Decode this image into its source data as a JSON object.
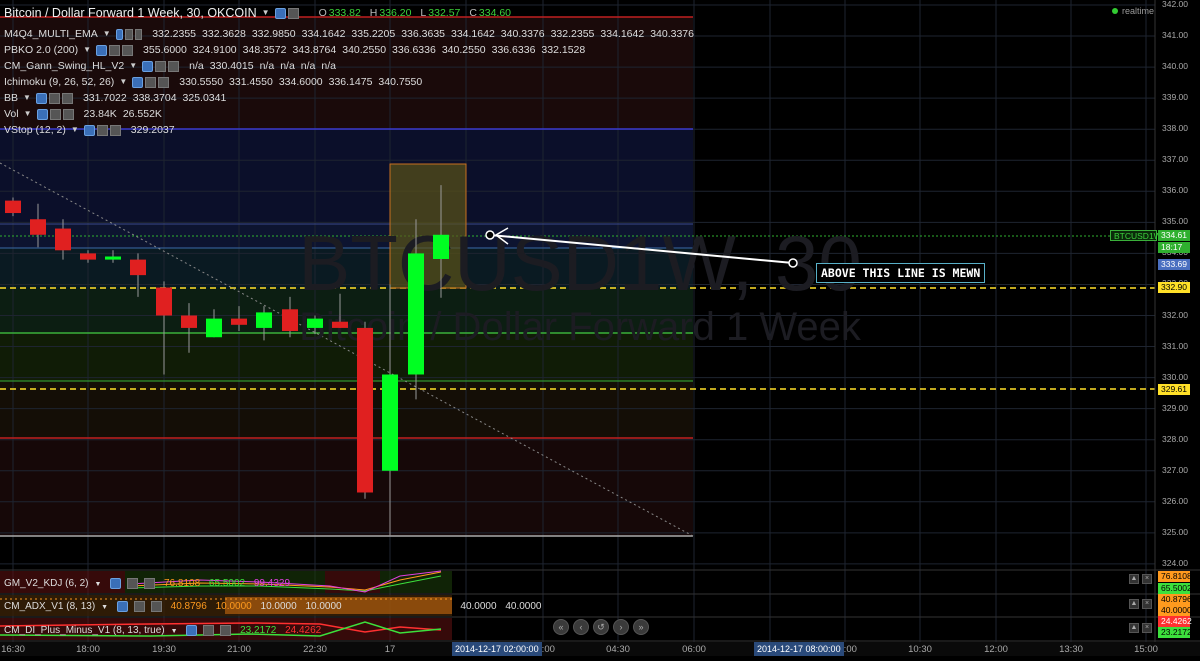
{
  "header": {
    "symbol_title": "Bitcoin / Dollar Forward 1 Week, 30, OKCOIN",
    "ohlc": [
      {
        "k": "O",
        "v": "333.82"
      },
      {
        "k": "H",
        "v": "336.20"
      },
      {
        "k": "L",
        "v": "332.57"
      },
      {
        "k": "C",
        "v": "334.60"
      }
    ],
    "realtime_label": "realtime"
  },
  "indicators": [
    {
      "name": "M4Q4_MULTI_EMA",
      "values": [
        "332.2355",
        "332.3628",
        "332.9850",
        "334.1642",
        "335.2205",
        "336.3635",
        "334.1642",
        "340.3376",
        "332.2355",
        "334.1642",
        "340.3376"
      ]
    },
    {
      "name": "PBKO 2.0 (200)",
      "values": [
        "355.6000",
        "324.9100",
        "348.3572",
        "343.8764",
        "340.2550",
        "336.6336",
        "340.2550",
        "336.6336",
        "332.1528"
      ]
    },
    {
      "name": "CM_Gann_Swing_HL_V2",
      "values": [
        "n/a",
        "330.4015",
        "n/a",
        "n/a",
        "n/a",
        "n/a"
      ]
    },
    {
      "name": "Ichimoku (9, 26, 52, 26)",
      "values": [
        "330.5550",
        "331.4550",
        "334.6000",
        "336.1475",
        "340.7550"
      ]
    },
    {
      "name": "BB",
      "values": [
        "331.7022",
        "338.3704",
        "325.0341"
      ]
    },
    {
      "name": "Vol",
      "values": [
        "23.84K",
        "26.552K"
      ]
    },
    {
      "name": "VStop (12, 2)",
      "values": [
        "329.2037"
      ]
    }
  ],
  "watermark": {
    "line1": "BTCUSD1W, 30",
    "line2": "Bitcoin / Dollar Forward 1 Week"
  },
  "annotation": {
    "text": "ABOVE THIS LINE IS MEWN"
  },
  "price_axis": [
    "342.00",
    "341.00",
    "340.00",
    "339.00",
    "338.00",
    "337.00",
    "336.00",
    "335.00",
    "334.00",
    "333.00",
    "332.00",
    "331.00",
    "330.00",
    "329.00",
    "328.00",
    "327.00",
    "326.00",
    "325.00",
    "324.00"
  ],
  "price_tags": {
    "symbol": "BTCUSD1W",
    "last": "334.61",
    "countdown": "18:17",
    "blue": "333.69",
    "yellow_upper": "332.90",
    "yellow_lower": "329.61"
  },
  "sub_panes": [
    {
      "name": "GM_V2_KDJ (6, 2)",
      "values": [
        "76.8108",
        "65.5002",
        "99.4329"
      ],
      "colors": [
        "#ff9a1e",
        "#3ce03c",
        "#e040e0"
      ],
      "axis_values": [
        "76.8108",
        "65.5002"
      ]
    },
    {
      "name": "CM_ADX_V1 (8, 13)",
      "values": [
        "40.8796",
        "10.0000",
        "10.0000",
        "10.0000",
        "40.0000",
        "40.0000"
      ],
      "colors": [
        "#ff9a1e",
        "#ff9a1e",
        "#ffffff",
        "#ffffff",
        "#ffffff",
        "#ffffff"
      ],
      "axis_values": [
        "40.8796",
        "40.0000"
      ]
    },
    {
      "name": "CM_DI_Plus_Minus_V1 (8, 13, true)",
      "values": [
        "23.2172",
        "24.4262"
      ],
      "colors": [
        "#3ce03c",
        "#ff3030"
      ],
      "axis_values": [
        "24.4262",
        "23.2172"
      ]
    }
  ],
  "time_axis": [
    "16:30",
    "18:00",
    "19:30",
    "21:00",
    "22:30",
    "17",
    "03:00",
    "04:30",
    "06:00",
    "09:00",
    "10:30",
    "12:00",
    "13:30",
    "15:00"
  ],
  "time_highlights": [
    "2014-12-17 02:00:00",
    "2014-12-17 08:00:00"
  ],
  "nav_buttons": [
    "«",
    "‹",
    "↺",
    "›",
    "»"
  ],
  "colors": {
    "bull": "#00ff22",
    "bear": "#e02020",
    "ema_line": "#3ab03a",
    "band_blue": "#3a3ad0",
    "band_red": "#c02020",
    "yellow": "#ffe028"
  },
  "chart_data": {
    "type": "candlestick",
    "ylim": [
      324.8,
      342.2
    ],
    "candles": [
      {
        "o": 335.7,
        "h": 335.8,
        "l": 335.2,
        "c": 335.3
      },
      {
        "o": 335.1,
        "h": 335.6,
        "l": 334.2,
        "c": 334.6
      },
      {
        "o": 334.8,
        "h": 335.1,
        "l": 333.8,
        "c": 334.1
      },
      {
        "o": 334.0,
        "h": 334.1,
        "l": 333.7,
        "c": 333.8
      },
      {
        "o": 333.8,
        "h": 334.1,
        "l": 333.7,
        "c": 333.9
      },
      {
        "o": 333.8,
        "h": 334.0,
        "l": 332.6,
        "c": 333.3
      },
      {
        "o": 332.9,
        "h": 333.1,
        "l": 330.1,
        "c": 332.0
      },
      {
        "o": 332.0,
        "h": 332.4,
        "l": 330.8,
        "c": 331.6
      },
      {
        "o": 331.3,
        "h": 332.2,
        "l": 331.3,
        "c": 331.9
      },
      {
        "o": 331.9,
        "h": 332.3,
        "l": 331.5,
        "c": 331.7
      },
      {
        "o": 331.6,
        "h": 332.3,
        "l": 331.2,
        "c": 332.1
      },
      {
        "o": 332.2,
        "h": 332.6,
        "l": 331.3,
        "c": 331.5
      },
      {
        "o": 331.6,
        "h": 332.0,
        "l": 331.4,
        "c": 331.9
      },
      {
        "o": 331.8,
        "h": 332.7,
        "l": 331.6,
        "c": 331.6
      },
      {
        "o": 331.6,
        "h": 331.8,
        "l": 326.1,
        "c": 326.3
      },
      {
        "o": 327.0,
        "h": 333.0,
        "l": 324.9,
        "c": 330.1
      },
      {
        "o": 330.1,
        "h": 335.1,
        "l": 329.3,
        "c": 334.0
      },
      {
        "o": 333.82,
        "h": 336.2,
        "l": 332.57,
        "c": 334.6
      }
    ]
  }
}
